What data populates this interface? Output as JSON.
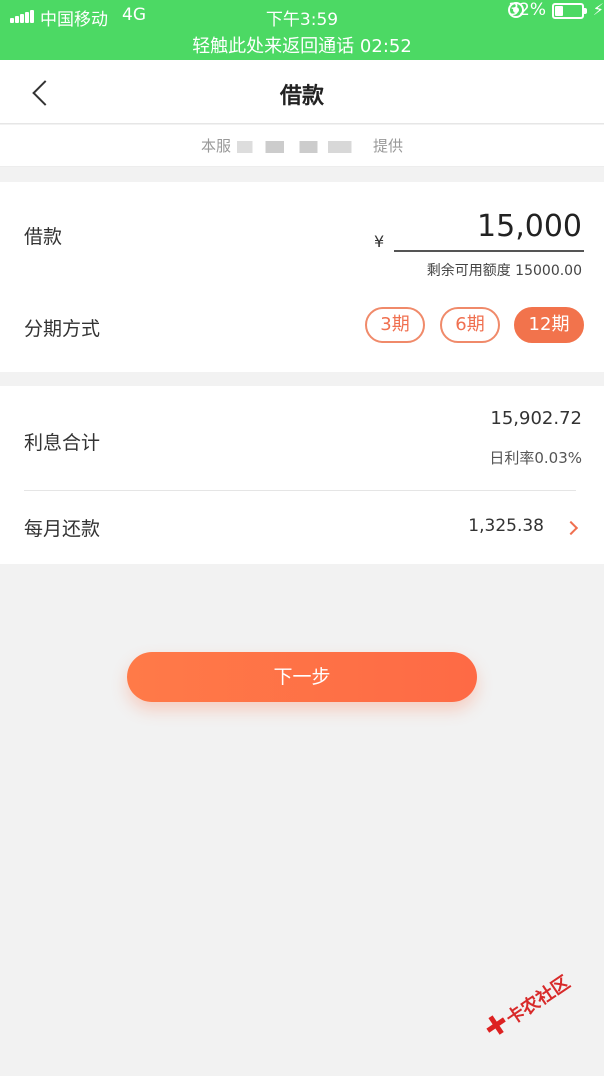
{
  "status_bar": {
    "carrier": "中国移动",
    "network": "4G",
    "time": "下午3:59",
    "battery_text": "32%",
    "battery_level": 0.32,
    "call_banner": "轻触此处来返回通话 02:52"
  },
  "nav": {
    "title": "借款"
  },
  "provider": {
    "prefix": "本服",
    "suffix": "提供"
  },
  "loan": {
    "label": "借款",
    "currency": "¥",
    "amount": "15,000",
    "remaining": "剩余可用额度 15000.00",
    "installment_label": "分期方式",
    "periods": [
      "3期",
      "6期",
      "12期"
    ],
    "selected_period": "12期"
  },
  "interest": {
    "label": "利息合计",
    "total": "15,902.72",
    "daily_rate": "日利率0.03%",
    "monthly_label": "每月还款",
    "monthly_value": "1,325.38"
  },
  "actions": {
    "next_label": "下一步"
  },
  "watermark": {
    "text": "卡农社区"
  },
  "colors": {
    "status_green": "#4cd964",
    "accent_orange": "#f2734c",
    "background": "#f2f2f2"
  }
}
